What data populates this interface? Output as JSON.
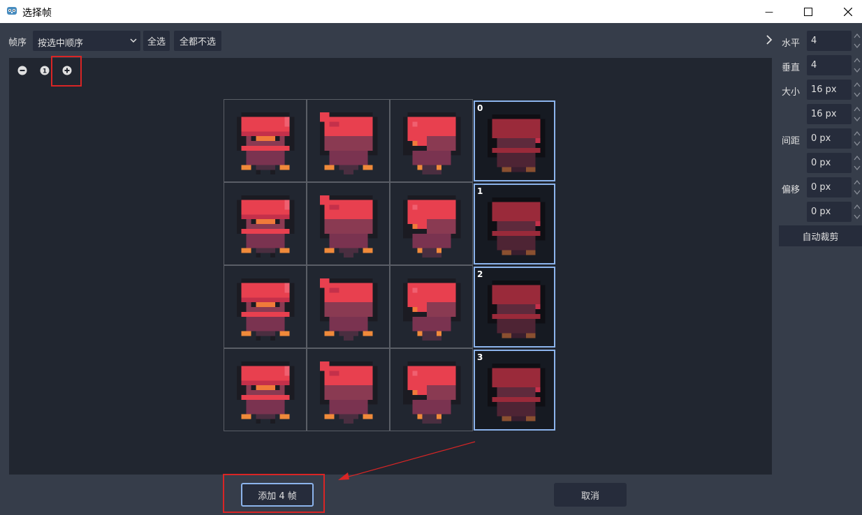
{
  "window": {
    "title": "选择帧",
    "minimize_glyph": "—",
    "maximize_glyph": "☐",
    "close_glyph": "✕"
  },
  "toolbar": {
    "frame_order_label": "帧序",
    "frame_order_value": "按选中顺序",
    "select_all_label": "全选",
    "select_none_label": "全都不选"
  },
  "zoom": {
    "zoom_out_icon": "minus-circle-icon",
    "reset_icon": "one-circle-icon",
    "zoom_in_icon": "plus-circle-icon"
  },
  "sidebar": {
    "horizontal_label": "水平",
    "horizontal_value": "4",
    "vertical_label": "垂直",
    "vertical_value": "4",
    "size_label": "大小",
    "size_x": "16 px",
    "size_y": "16 px",
    "separation_label": "间距",
    "separation_x": "0 px",
    "separation_y": "0 px",
    "offset_label": "偏移",
    "offset_x": "0 px",
    "offset_y": "0 px",
    "auto_slice_label": "自动裁剪"
  },
  "frames": {
    "columns": 4,
    "rows": 4,
    "selected_column": 3,
    "selected_indices": [
      "0",
      "1",
      "2",
      "3"
    ]
  },
  "footer": {
    "add_label": "添加 4 帧",
    "cancel_label": "取消"
  },
  "colors": {
    "background": "#363d4a",
    "canvas": "#212630",
    "field": "#262c3b",
    "selection_border": "#8cb4ec",
    "annotation_red": "#d92525"
  }
}
